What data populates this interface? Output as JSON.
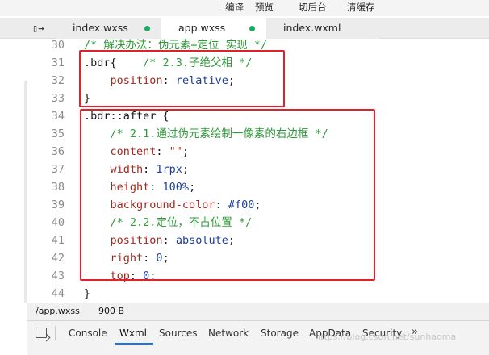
{
  "toolbar": {
    "compile": "编译",
    "preview": "预览",
    "background": "切后台",
    "clear_cache": "清缓存"
  },
  "tabs": {
    "toggle_icon": "sidebar-toggle-icon",
    "items": [
      {
        "label": "index.wxss",
        "modified": true
      },
      {
        "label": "app.wxss",
        "modified": true,
        "active": true
      },
      {
        "label": "index.wxml",
        "modified": false
      }
    ]
  },
  "editor": {
    "lines": [
      {
        "num": "30",
        "parts": [
          {
            "t": "/* 解决办法：伪元素+定位 实现 */",
            "c": "comment"
          }
        ]
      },
      {
        "num": "31",
        "parts": [
          {
            "t": ".bdr{",
            "c": "sel"
          },
          {
            "t": "    /* 2.3.子绝父相 */",
            "c": "comment"
          }
        ]
      },
      {
        "num": "32",
        "parts": [
          {
            "t": "    position",
            "c": "prop"
          },
          {
            "t": ": ",
            "c": "punct"
          },
          {
            "t": "relative",
            "c": "val"
          },
          {
            "t": ";",
            "c": "punct"
          }
        ]
      },
      {
        "num": "33",
        "parts": [
          {
            "t": "}",
            "c": "sel"
          }
        ]
      },
      {
        "num": "34",
        "parts": [
          {
            "t": ".bdr::after {",
            "c": "sel"
          }
        ]
      },
      {
        "num": "35",
        "parts": [
          {
            "t": "    /* 2.1.通过伪元素绘制一像素的右边框 */",
            "c": "comment"
          }
        ]
      },
      {
        "num": "36",
        "parts": [
          {
            "t": "    content",
            "c": "prop"
          },
          {
            "t": ": ",
            "c": "punct"
          },
          {
            "t": "\"\"",
            "c": "str"
          },
          {
            "t": ";",
            "c": "punct"
          }
        ]
      },
      {
        "num": "37",
        "parts": [
          {
            "t": "    width",
            "c": "prop"
          },
          {
            "t": ": ",
            "c": "punct"
          },
          {
            "t": "1rpx",
            "c": "val"
          },
          {
            "t": ";",
            "c": "punct"
          }
        ]
      },
      {
        "num": "38",
        "parts": [
          {
            "t": "    height",
            "c": "prop"
          },
          {
            "t": ": ",
            "c": "punct"
          },
          {
            "t": "100%",
            "c": "val"
          },
          {
            "t": ";",
            "c": "punct"
          }
        ]
      },
      {
        "num": "39",
        "parts": [
          {
            "t": "    background-color",
            "c": "prop"
          },
          {
            "t": ": ",
            "c": "punct"
          },
          {
            "t": "#f00",
            "c": "val"
          },
          {
            "t": ";",
            "c": "punct"
          }
        ]
      },
      {
        "num": "40",
        "parts": [
          {
            "t": "    /* 2.2.定位，不占位置 */",
            "c": "comment"
          }
        ]
      },
      {
        "num": "41",
        "parts": [
          {
            "t": "    position",
            "c": "prop"
          },
          {
            "t": ": ",
            "c": "punct"
          },
          {
            "t": "absolute",
            "c": "val"
          },
          {
            "t": ";",
            "c": "punct"
          }
        ]
      },
      {
        "num": "42",
        "parts": [
          {
            "t": "    right",
            "c": "prop"
          },
          {
            "t": ": ",
            "c": "punct"
          },
          {
            "t": "0",
            "c": "val"
          },
          {
            "t": ";",
            "c": "punct"
          }
        ]
      },
      {
        "num": "43",
        "parts": [
          {
            "t": "    top",
            "c": "prop"
          },
          {
            "t": ": ",
            "c": "punct"
          },
          {
            "t": "0",
            "c": "val"
          },
          {
            "t": ";",
            "c": "punct"
          }
        ]
      },
      {
        "num": "44",
        "parts": [
          {
            "t": "}",
            "c": "sel"
          }
        ]
      }
    ]
  },
  "status": {
    "file_path": "/app.wxss",
    "file_size": "900 B"
  },
  "devtools": {
    "tabs": [
      "Console",
      "Wxml",
      "Sources",
      "Network",
      "Storage",
      "AppData",
      "Security"
    ],
    "active_tab": "Wxml",
    "more": "»"
  },
  "watermark": "https://blog.csdn.net/sunhaoma"
}
